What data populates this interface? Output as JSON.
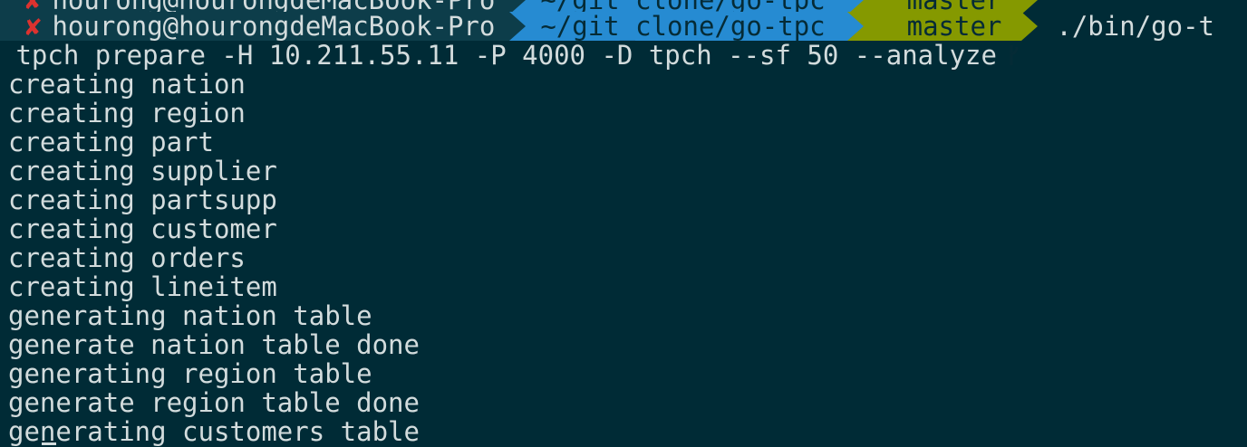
{
  "prompt": {
    "user_host": "hourong@hourongdeMacBook-Pro",
    "error_mark": "✘",
    "directory": "~/git_clone/go-tpc",
    "branch": "master",
    "command_start": "./bin/go-t",
    "command_cont": " tpch prepare -H 10.211.55.11 -P 4000 -D tpch --sf 50 --analyze"
  },
  "output_lines": [
    "creating nation",
    "creating region",
    "creating part",
    "creating supplier",
    "creating partsupp",
    "creating customer",
    "creating orders",
    "creating lineitem",
    "generating nation table",
    "generate nation table done",
    "generating region table",
    "generate region table done",
    "generating customers table"
  ],
  "colors": {
    "background": "#002b36",
    "text": "#d3dcdd",
    "error": "#dc322f",
    "dir_segment": "#268bd2",
    "branch_segment": "#859900",
    "user_segment": "#0d3d4a"
  }
}
